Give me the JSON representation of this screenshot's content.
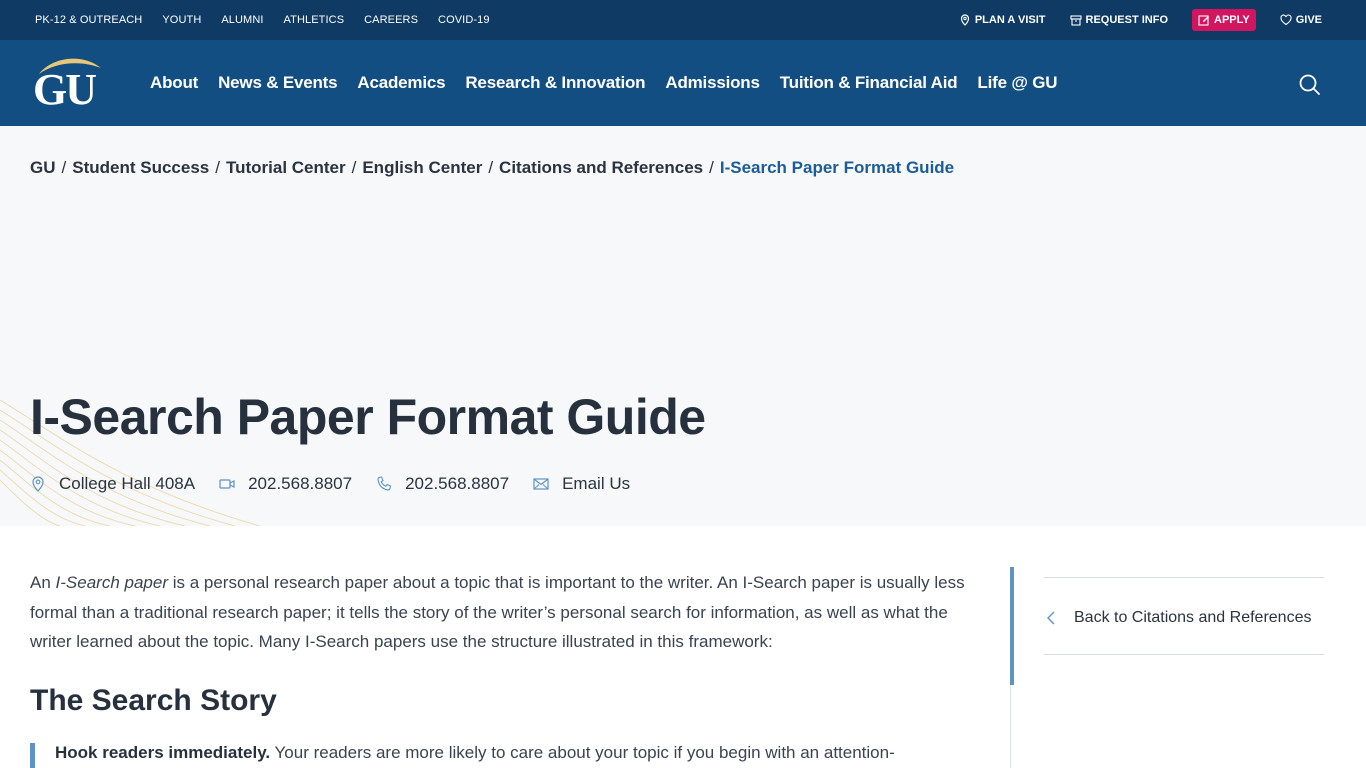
{
  "utility": {
    "left_links": [
      "PK-12 & OUTREACH",
      "YOUTH",
      "ALUMNI",
      "ATHLETICS",
      "CAREERS",
      "COVID-19"
    ],
    "plan_visit": "PLAN A VISIT",
    "request_info": "REQUEST INFO",
    "apply": "APPLY",
    "give": "GIVE"
  },
  "logo": {
    "text": "GU"
  },
  "nav": {
    "links": [
      "About",
      "News & Events",
      "Academics",
      "Research & Innovation",
      "Admissions",
      "Tuition & Financial Aid",
      "Life @ GU"
    ]
  },
  "breadcrumb": {
    "items": [
      "GU",
      "Student Success",
      "Tutorial Center",
      "English Center",
      "Citations and References"
    ],
    "current": "I-Search Paper Format Guide"
  },
  "page": {
    "title": "I-Search Paper Format Guide"
  },
  "contact": {
    "location": "College Hall 408A",
    "video_phone": "202.568.8807",
    "phone": "202.568.8807",
    "email": "Email Us"
  },
  "content": {
    "intro_prefix": "An ",
    "intro_term": "I-Search paper",
    "intro_rest": " is a personal research paper about a topic that is important to the writer. An I-Search paper is usually less formal than a traditional research paper; it tells the story of the writer’s personal search for information, as well as what the writer learned about the topic. Many I-Search papers use the structure illustrated in this framework:",
    "heading": "The Search Story",
    "hook_bold": "Hook readers immediately.",
    "hook_text": " Your readers are more likely to care about your topic if you begin with an attention-"
  },
  "sidebar": {
    "back_link": "Back to Citations and References"
  },
  "colors": {
    "utility_bg": "#0e3a63",
    "nav_bg": "#124e82",
    "apply_bg": "#d2155f",
    "accent_blue": "#5e93c4",
    "gold": "#e8c77a"
  }
}
